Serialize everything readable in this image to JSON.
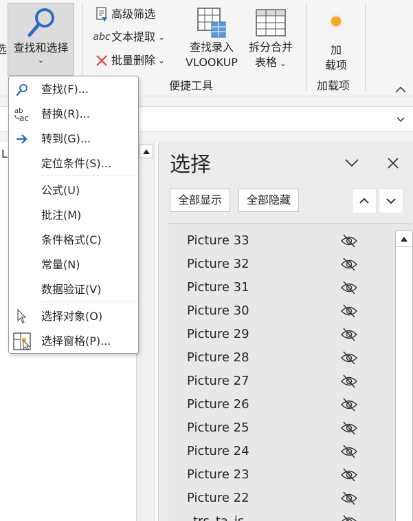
{
  "ribbon": {
    "find_select": {
      "label": "查找和选择",
      "cut_left_char": "选"
    },
    "advanced_filter": "高级筛选",
    "text_extract": "文本提取",
    "batch_delete": "批量删除",
    "find_entry": {
      "line1": "查找录入",
      "line2": "VLOOKUP"
    },
    "split_merge": {
      "line1": "拆分合并",
      "line2": "表格"
    },
    "addin": {
      "line1": "加",
      "line2": "载项"
    },
    "groups": {
      "quick_tools": "便捷工具",
      "addins": "加载项"
    },
    "cut_left_label": "L"
  },
  "menu": {
    "items": [
      {
        "label": "查找(F)...",
        "icon": "search-icon"
      },
      {
        "label": "替换(R)...",
        "icon": "replace-icon"
      },
      {
        "label": "转到(G)...",
        "icon": "arrow-right-icon"
      },
      {
        "label": "定位条件(S)...",
        "icon": ""
      },
      {
        "label": "公式(U)",
        "icon": ""
      },
      {
        "label": "批注(M)",
        "icon": ""
      },
      {
        "label": "条件格式(C)",
        "icon": ""
      },
      {
        "label": "常量(N)",
        "icon": ""
      },
      {
        "label": "数据验证(V)",
        "icon": ""
      },
      {
        "label": "选择对象(O)",
        "icon": "pointer-icon"
      },
      {
        "label": "选择窗格(P)...",
        "icon": "selection-pane-icon"
      }
    ]
  },
  "pane": {
    "title": "选择",
    "show_all": "全部显示",
    "hide_all": "全部隐藏",
    "items": [
      "Picture 33",
      "Picture 32",
      "Picture 31",
      "Picture 30",
      "Picture 29",
      "Picture 28",
      "Picture 27",
      "Picture 26",
      "Picture 25",
      "Picture 24",
      "Picture 23",
      "Picture 22",
      "_trs_ta_is"
    ]
  },
  "colors": {
    "accent_blue": "#2b6cc4",
    "delete_red": "#e04040",
    "addin_orange": "#f5a623"
  }
}
